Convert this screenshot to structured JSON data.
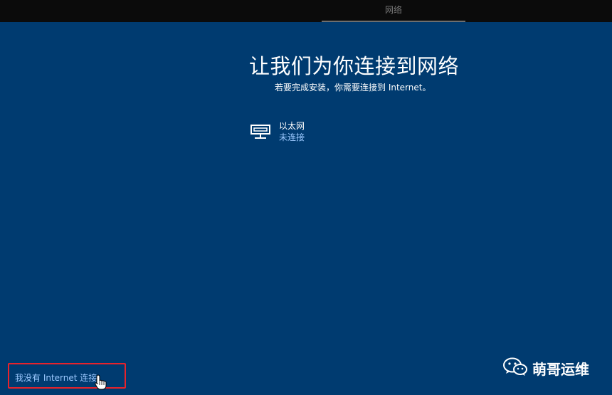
{
  "topbar": {
    "tab_label": "网络"
  },
  "main": {
    "title": "让我们为你连接到网络",
    "subtitle": "若要完成安装，你需要连接到 Internet。"
  },
  "network": {
    "icon": "ethernet-icon",
    "name": "以太网",
    "status": "未连接"
  },
  "footer": {
    "no_internet_label": "我没有 Internet 连接"
  },
  "watermark": {
    "icon": "wechat-icon",
    "text": "萌哥运维"
  },
  "colors": {
    "background": "#003b70",
    "topbar": "#0b0b0b",
    "link": "#9cc9ff",
    "highlight_box": "#e8232b"
  }
}
